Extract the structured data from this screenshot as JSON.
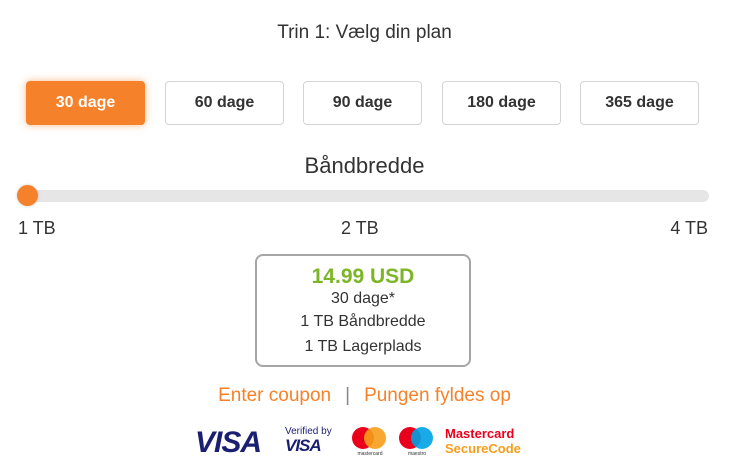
{
  "step_title": "Trin 1: Vælg din plan",
  "plans": [
    {
      "label": "30 dage",
      "active": true
    },
    {
      "label": "60 dage",
      "active": false
    },
    {
      "label": "90 dage",
      "active": false
    },
    {
      "label": "180 dage",
      "active": false
    },
    {
      "label": "365 dage",
      "active": false
    }
  ],
  "bandwidth": {
    "title": "Båndbredde",
    "ticks": [
      "1 TB",
      "2 TB",
      "4 TB"
    ],
    "selected_index": 0
  },
  "summary": {
    "price": "14.99 USD",
    "duration": "30 dage*",
    "bandwidth": "1 TB Båndbredde",
    "storage": "1 TB Lagerplads"
  },
  "links": {
    "coupon": "Enter coupon",
    "separator": "|",
    "wallet": "Pungen fyldes op"
  },
  "payments": {
    "visa": "VISA",
    "verified_line1": "Verified by",
    "verified_line2": "VISA",
    "mastercard_small": "mastercard",
    "maestro_small": "maestro",
    "securecode_line1": "Mastercard",
    "securecode_line2": "SecureCode"
  },
  "colors": {
    "accent": "#f5822a",
    "price": "#7cb526",
    "visa_blue": "#1a1f71"
  }
}
